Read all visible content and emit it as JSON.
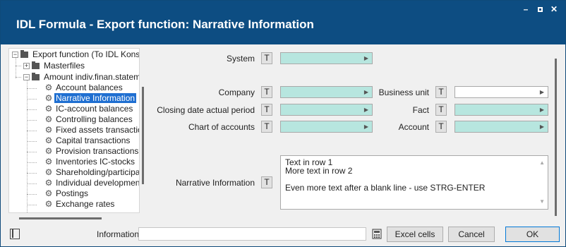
{
  "window": {
    "title": "IDL Formula - Export function: Narrative Information"
  },
  "tree": {
    "items": [
      {
        "label": "Export function (To IDL Konsis",
        "kind": "folder",
        "toggle": "−"
      },
      {
        "label": "Masterfiles",
        "kind": "folder",
        "toggle": "+"
      },
      {
        "label": "Amount indiv.finan.stateme",
        "kind": "folder",
        "toggle": "−"
      },
      {
        "label": "Account balances",
        "kind": "gear"
      },
      {
        "label": "Narrative Information",
        "kind": "gear",
        "selected": true
      },
      {
        "label": "IC-account balances",
        "kind": "gear"
      },
      {
        "label": "Controlling balances",
        "kind": "gear"
      },
      {
        "label": "Fixed assets transactio",
        "kind": "gear"
      },
      {
        "label": "Capital transactions",
        "kind": "gear"
      },
      {
        "label": "Provision transactions",
        "kind": "gear"
      },
      {
        "label": "Inventories IC-stocks",
        "kind": "gear"
      },
      {
        "label": "Shareholding/participati",
        "kind": "gear"
      },
      {
        "label": "Individual development t",
        "kind": "gear"
      },
      {
        "label": "Postings",
        "kind": "gear"
      },
      {
        "label": "Exchange rates",
        "kind": "gear"
      }
    ]
  },
  "form": {
    "t_label": "T",
    "system_label": "System",
    "company_label": "Company",
    "business_unit_label": "Business unit",
    "closing_date_label": "Closing date actual period",
    "fact_label": "Fact",
    "chart_of_accounts_label": "Chart of accounts",
    "account_label": "Account",
    "narrative_label": "Narrative Information",
    "narrative_lines": [
      "Text in row 1",
      "More text in row 2",
      "",
      "Even more text after a blank line - use STRG-ENTER"
    ]
  },
  "bottom": {
    "info_label": "Information",
    "excel_button": "Excel cells",
    "cancel_button": "Cancel",
    "ok_button": "OK"
  },
  "colors": {
    "titlebar": "#0d4d82",
    "field_fill": "#b7e6df",
    "selection": "#1f6fd1"
  }
}
